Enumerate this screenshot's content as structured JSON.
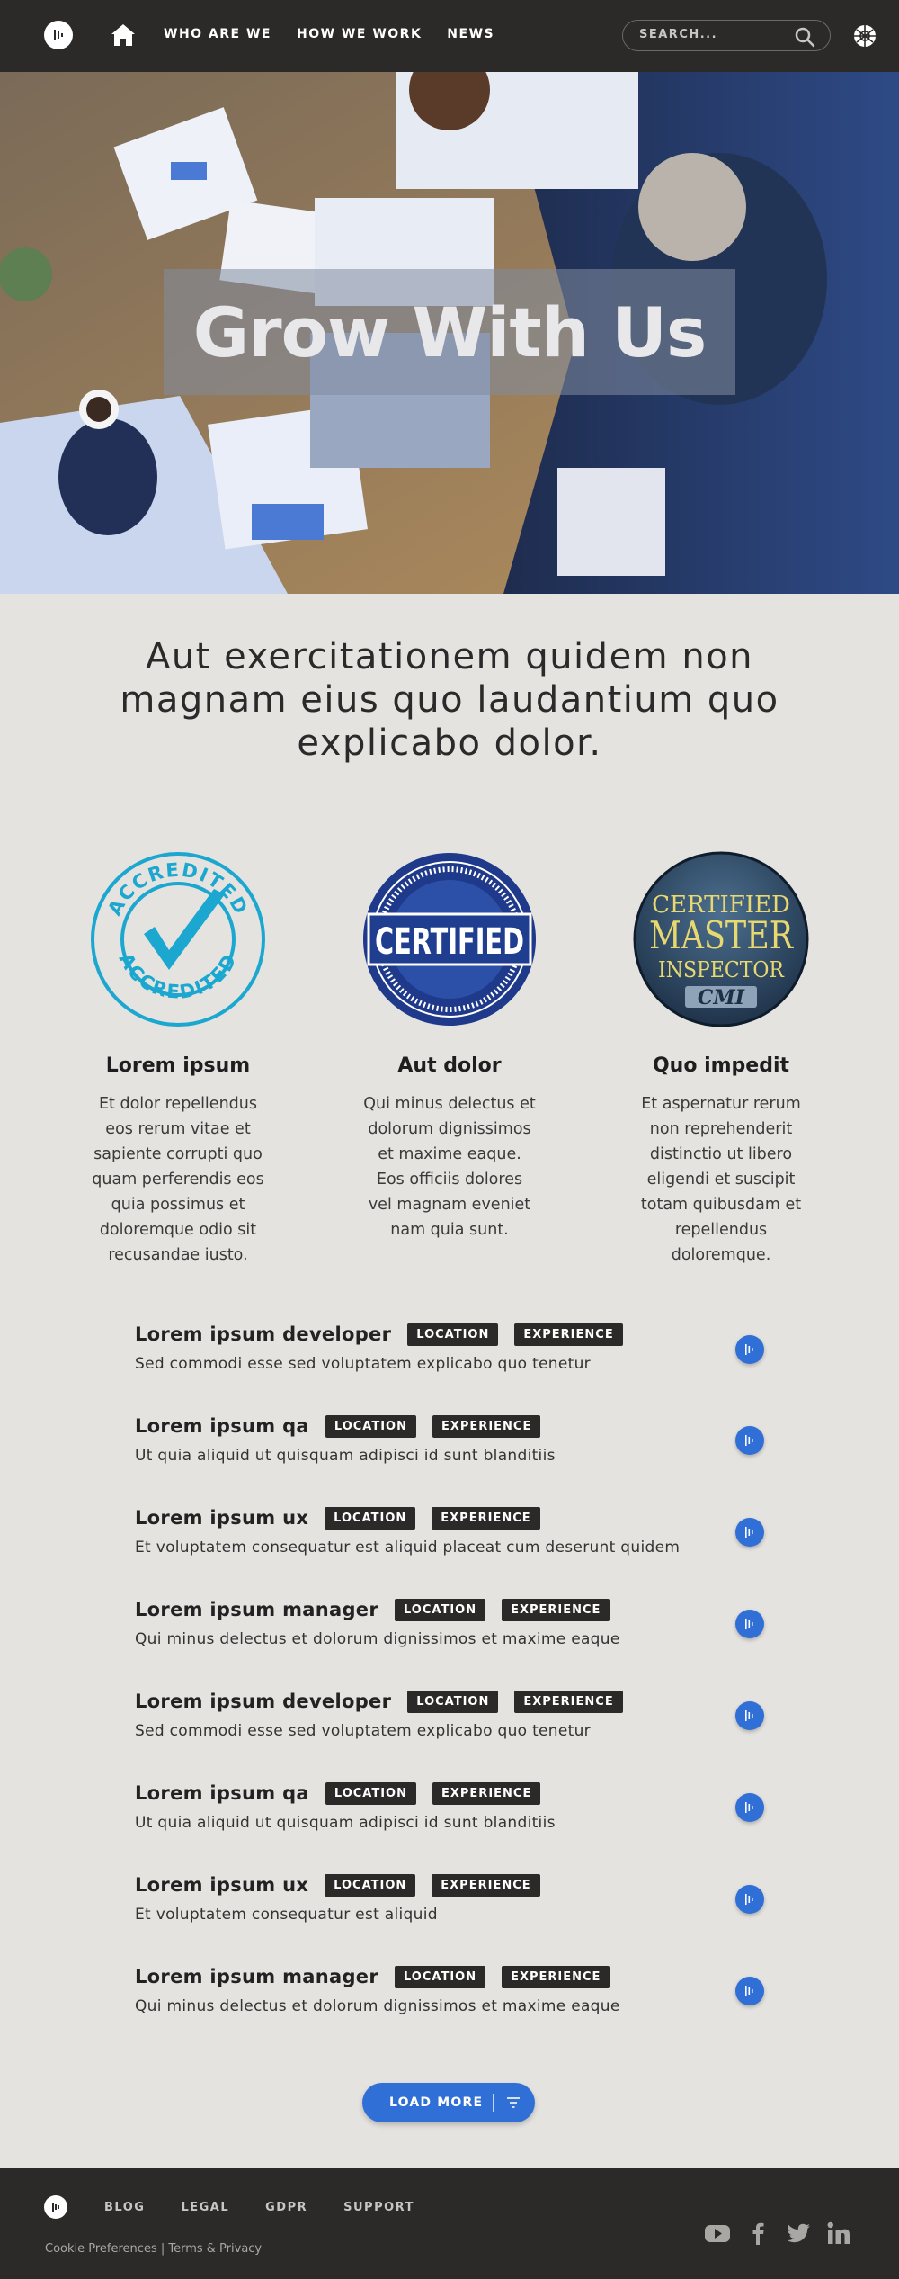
{
  "header": {
    "nav": [
      "WHO ARE WE",
      "HOW WE WORK",
      "NEWS"
    ],
    "search_placeholder": "SEARCH..."
  },
  "hero": {
    "title": "Grow With Us"
  },
  "headline": "Aut exercitationem quidem non magnam eius quo laudantium quo explicabo dolor.",
  "features": [
    {
      "badge_text": [
        "ACCREDITED",
        "ACCREDITED"
      ],
      "title": "Lorem ipsum",
      "text": "Et dolor repellendus eos rerum vitae et sapiente corrupti quo quam perferendis eos quia possimus et doloremque odio sit recusandae iusto."
    },
    {
      "badge_text": [
        "CERTIFIED"
      ],
      "title": "Aut dolor",
      "text": "Qui minus delectus et dolorum dignissimos et maxime eaque. Eos officiis dolores vel magnam eveniet nam quia sunt."
    },
    {
      "badge_text": [
        "CERTIFIED",
        "MASTER",
        "INSPECTOR",
        "CMI"
      ],
      "title": "Quo impedit",
      "text": "Et aspernatur rerum non reprehenderit distinctio ut libero eligendi et suscipit totam quibusdam et repellendus doloremque."
    }
  ],
  "jobs": [
    {
      "title": "Lorem ipsum developer",
      "tag1": "LOCATION",
      "tag2": "EXPERIENCE",
      "desc": "Sed commodi esse sed voluptatem explicabo quo tenetur"
    },
    {
      "title": "Lorem ipsum qa",
      "tag1": "LOCATION",
      "tag2": "EXPERIENCE",
      "desc": "Ut quia aliquid ut quisquam adipisci id sunt blanditiis"
    },
    {
      "title": "Lorem ipsum ux",
      "tag1": "LOCATION",
      "tag2": "EXPERIENCE",
      "desc": "Et voluptatem consequatur est aliquid placeat cum deserunt quidem"
    },
    {
      "title": "Lorem ipsum manager",
      "tag1": "LOCATION",
      "tag2": "EXPERIENCE",
      "desc": "Qui minus delectus et dolorum dignissimos et maxime eaque"
    },
    {
      "title": "Lorem ipsum developer",
      "tag1": "LOCATION",
      "tag2": "EXPERIENCE",
      "desc": "Sed commodi esse sed voluptatem explicabo quo tenetur"
    },
    {
      "title": "Lorem ipsum qa",
      "tag1": "LOCATION",
      "tag2": "EXPERIENCE",
      "desc": "Ut quia aliquid ut quisquam adipisci id sunt blanditiis"
    },
    {
      "title": "Lorem ipsum ux",
      "tag1": "LOCATION",
      "tag2": "EXPERIENCE",
      "desc": "Et voluptatem consequatur est aliquid"
    },
    {
      "title": "Lorem ipsum manager",
      "tag1": "LOCATION",
      "tag2": "EXPERIENCE",
      "desc": "Qui minus delectus et dolorum dignissimos et maxime eaque"
    }
  ],
  "load_more": "LOAD MORE",
  "footer": {
    "nav": [
      "BLOG",
      "LEGAL",
      "GDPR",
      "SUPPORT"
    ],
    "cookie": "Cookie Preferences",
    "separator": " | ",
    "terms": "Terms & Privacy",
    "social": [
      "youtube-icon",
      "facebook-icon",
      "twitter-icon",
      "linkedin-icon"
    ]
  },
  "colors": {
    "dark": "#2b2a28",
    "background": "#e5e3e0",
    "accent_blue": "#2f6fd6",
    "accredited_cyan": "#1ba7cf",
    "certified_navy": "#1f3a8a",
    "cmi_gold": "#e8d870"
  }
}
